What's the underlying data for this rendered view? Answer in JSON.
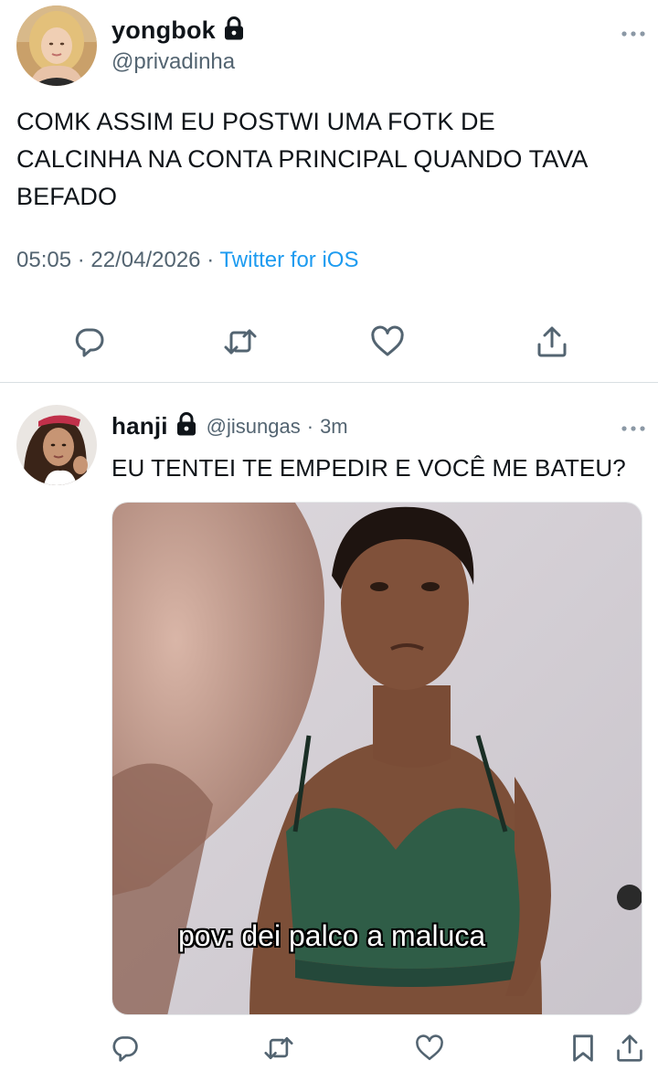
{
  "main_tweet": {
    "display_name": "yongbok",
    "handle": "@privadinha",
    "text_lines": [
      "COMK ASSIM EU POSTWI UMA FOTK DE",
      "CALCINHA NA CONTA PRINCIPAL QUANDO TAVA",
      "BEFADO"
    ],
    "time": "05:05",
    "date": "22/04/2026",
    "separator": "·",
    "source": "Twitter for iOS",
    "actions": [
      "reply-icon",
      "retweet-icon",
      "like-icon",
      "share-icon"
    ]
  },
  "reply_tweet": {
    "display_name": "hanji",
    "handle": "@jisungas",
    "time_ago": "3m",
    "separator": "·",
    "text": "EU TENTEI TE EMPEDIR E VOCÊ ME BATEU?",
    "media_caption": "pov: dei palco a maluca",
    "actions": [
      "reply-icon",
      "retweet-icon",
      "like-icon",
      "bookmark-icon",
      "share-icon"
    ]
  },
  "colors": {
    "text": "#0f1419",
    "secondary": "#536471",
    "link": "#1d9bf0",
    "divider": "#d9dfe3"
  }
}
